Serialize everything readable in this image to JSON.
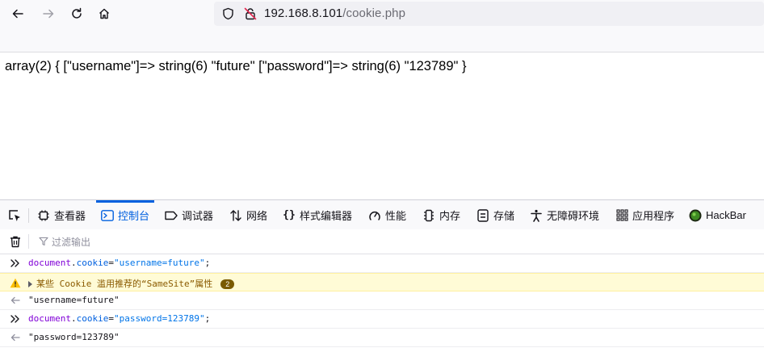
{
  "browser": {
    "url_host": "192.168.8.101",
    "url_path": "/cookie.php"
  },
  "page": {
    "output": "array(2) { [\"username\"]=> string(6) \"future\" [\"password\"]=> string(6) \"123789\" }"
  },
  "devtools": {
    "tabs": [
      {
        "label": "查看器",
        "icon": "inspector-icon"
      },
      {
        "label": "控制台",
        "icon": "console-icon",
        "active": true
      },
      {
        "label": "调试器",
        "icon": "debugger-icon"
      },
      {
        "label": "网络",
        "icon": "network-icon"
      },
      {
        "label": "样式编辑器",
        "icon": "style-editor-icon"
      },
      {
        "label": "性能",
        "icon": "performance-icon"
      },
      {
        "label": "内存",
        "icon": "memory-icon"
      },
      {
        "label": "存储",
        "icon": "storage-icon"
      },
      {
        "label": "无障碍环境",
        "icon": "accessibility-icon"
      },
      {
        "label": "应用程序",
        "icon": "application-icon"
      },
      {
        "label": "HackBar",
        "icon": "hackbar-icon"
      }
    ],
    "filter_placeholder": "过滤输出",
    "console": {
      "input1": {
        "obj": "document",
        "dot": ".",
        "prop": "cookie",
        "eq": "=",
        "str": "\"username=future\"",
        "semi": ";"
      },
      "warning": {
        "text": "某些 Cookie 滥用推荐的“SameSite”属性",
        "count": "2"
      },
      "output1": "\"username=future\"",
      "input2": {
        "obj": "document",
        "dot": ".",
        "prop": "cookie",
        "eq": "=",
        "str": "\"password=123789\"",
        "semi": ";"
      },
      "output2": "\"password=123789\""
    }
  },
  "colors": {
    "accent": "#0060df",
    "warning_bg": "#fffbd6",
    "badge": "#7a5a00"
  }
}
